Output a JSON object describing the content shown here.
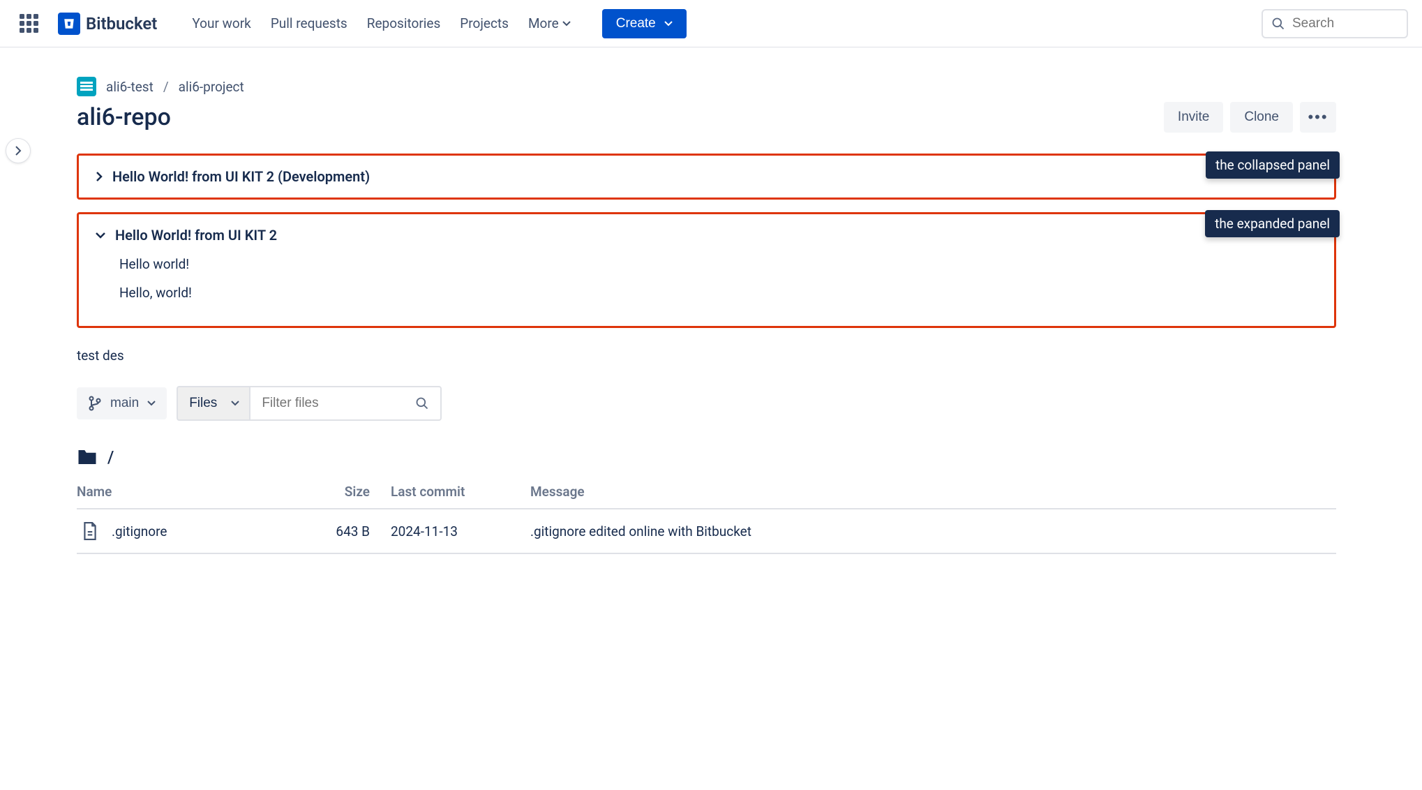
{
  "header": {
    "brand": "Bitbucket",
    "nav": [
      "Your work",
      "Pull requests",
      "Repositories",
      "Projects",
      "More"
    ],
    "create": "Create",
    "searchPlaceholder": "Search"
  },
  "breadcrumb": {
    "workspace": "ali6-test",
    "project": "ali6-project"
  },
  "repo": {
    "title": "ali6-repo",
    "actions": {
      "invite": "Invite",
      "clone": "Clone"
    }
  },
  "panels": {
    "collapsed": {
      "title": "Hello World! from UI KIT 2 (Development)",
      "badge": "the collapsed panel"
    },
    "expanded": {
      "title": "Hello World! from UI KIT 2",
      "badge": "the expanded panel",
      "body": [
        "Hello world!",
        "Hello, world!"
      ]
    }
  },
  "description": "test des",
  "toolbar": {
    "branch": "main",
    "files": "Files",
    "filterPlaceholder": "Filter files"
  },
  "path": "/",
  "table": {
    "headers": {
      "name": "Name",
      "size": "Size",
      "commit": "Last commit",
      "message": "Message"
    },
    "rows": [
      {
        "name": ".gitignore",
        "size": "643 B",
        "commit": "2024-11-13",
        "message": ".gitignore edited online with Bitbucket"
      }
    ]
  }
}
